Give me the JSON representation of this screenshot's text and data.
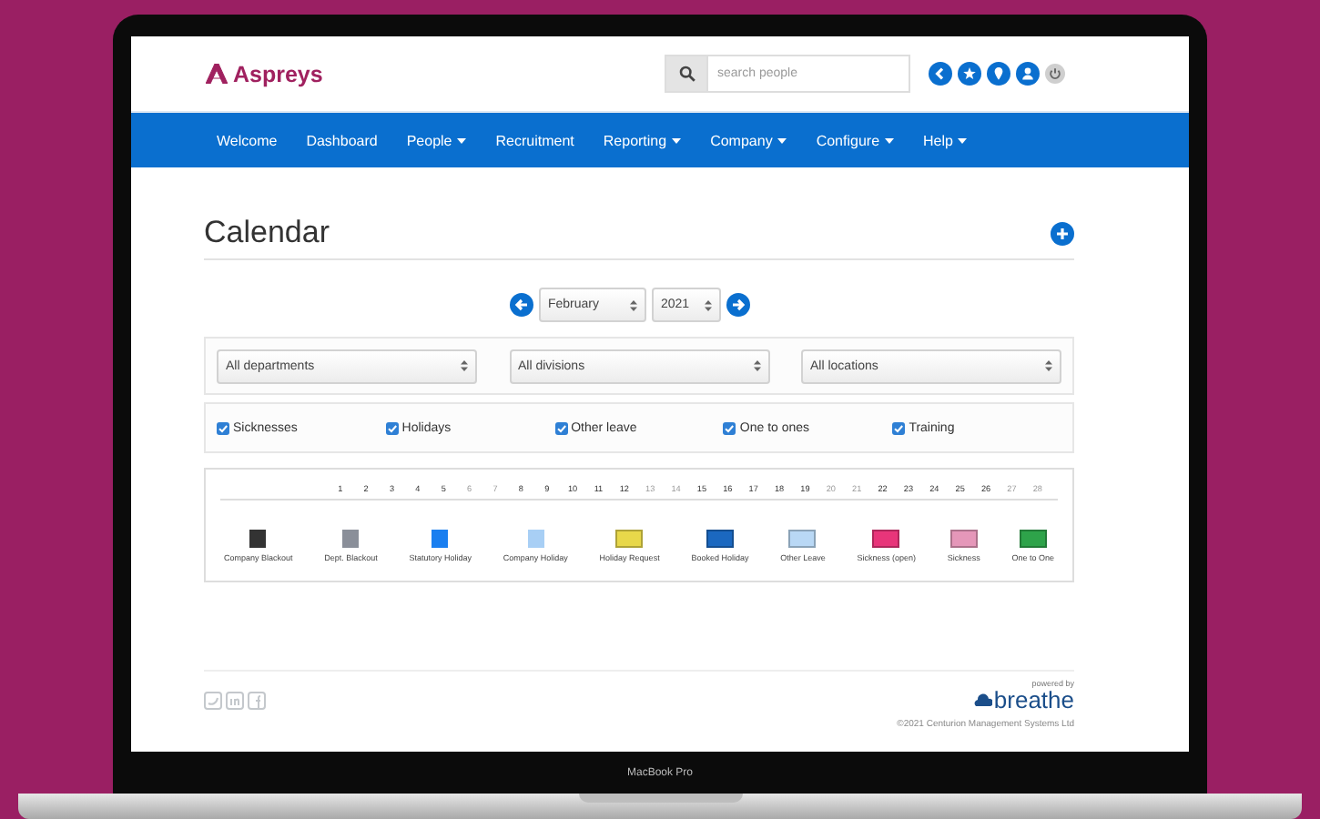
{
  "brand": {
    "name": "Aspreys"
  },
  "search": {
    "placeholder": "search people"
  },
  "nav": [
    {
      "label": "Welcome",
      "dropdown": false
    },
    {
      "label": "Dashboard",
      "dropdown": false
    },
    {
      "label": "People",
      "dropdown": true
    },
    {
      "label": "Recruitment",
      "dropdown": false
    },
    {
      "label": "Reporting",
      "dropdown": true
    },
    {
      "label": "Company",
      "dropdown": true
    },
    {
      "label": "Configure",
      "dropdown": true
    },
    {
      "label": "Help",
      "dropdown": true
    }
  ],
  "page": {
    "title": "Calendar"
  },
  "month_select": {
    "value": "February"
  },
  "year_select": {
    "value": "2021"
  },
  "filters": [
    {
      "value": "All departments"
    },
    {
      "value": "All divisions"
    },
    {
      "value": "All locations"
    }
  ],
  "toggles": [
    {
      "label": "Sicknesses",
      "checked": true
    },
    {
      "label": "Holidays",
      "checked": true
    },
    {
      "label": "Other leave",
      "checked": true
    },
    {
      "label": "One to ones",
      "checked": true
    },
    {
      "label": "Training",
      "checked": true
    }
  ],
  "days": [
    {
      "label": "1",
      "weekend": false
    },
    {
      "label": "2",
      "weekend": false
    },
    {
      "label": "3",
      "weekend": false
    },
    {
      "label": "4",
      "weekend": false
    },
    {
      "label": "5",
      "weekend": false
    },
    {
      "label": "6",
      "weekend": true
    },
    {
      "label": "7",
      "weekend": true
    },
    {
      "label": "8",
      "weekend": false
    },
    {
      "label": "9",
      "weekend": false
    },
    {
      "label": "10",
      "weekend": false
    },
    {
      "label": "11",
      "weekend": false
    },
    {
      "label": "12",
      "weekend": false
    },
    {
      "label": "13",
      "weekend": true
    },
    {
      "label": "14",
      "weekend": true
    },
    {
      "label": "15",
      "weekend": false
    },
    {
      "label": "16",
      "weekend": false
    },
    {
      "label": "17",
      "weekend": false
    },
    {
      "label": "18",
      "weekend": false
    },
    {
      "label": "19",
      "weekend": false
    },
    {
      "label": "20",
      "weekend": true
    },
    {
      "label": "21",
      "weekend": true
    },
    {
      "label": "22",
      "weekend": false
    },
    {
      "label": "23",
      "weekend": false
    },
    {
      "label": "24",
      "weekend": false
    },
    {
      "label": "25",
      "weekend": false
    },
    {
      "label": "26",
      "weekend": false
    },
    {
      "label": "27",
      "weekend": true
    },
    {
      "label": "28",
      "weekend": true
    }
  ],
  "legend": [
    {
      "label": "Company Blackout",
      "color": "#333333"
    },
    {
      "label": "Dept. Blackout",
      "color": "#8a8f99"
    },
    {
      "label": "Statutory Holiday",
      "color": "#1a7ff0"
    },
    {
      "label": "Company Holiday",
      "color": "#a8cff5"
    },
    {
      "label": "Holiday Request",
      "color": "#e8d84a"
    },
    {
      "label": "Booked Holiday",
      "color": "#1b68c0"
    },
    {
      "label": "Other Leave",
      "color": "#b9d8f5"
    },
    {
      "label": "Sickness (open)",
      "color": "#e8357a"
    },
    {
      "label": "Sickness",
      "color": "#e597b9"
    },
    {
      "label": "One to One",
      "color": "#2ea34a"
    }
  ],
  "footer": {
    "powered_by": "powered by",
    "logo": "breathe",
    "copyright": "©2021 Centurion Management Systems Ltd"
  },
  "device": {
    "label": "MacBook Pro"
  }
}
